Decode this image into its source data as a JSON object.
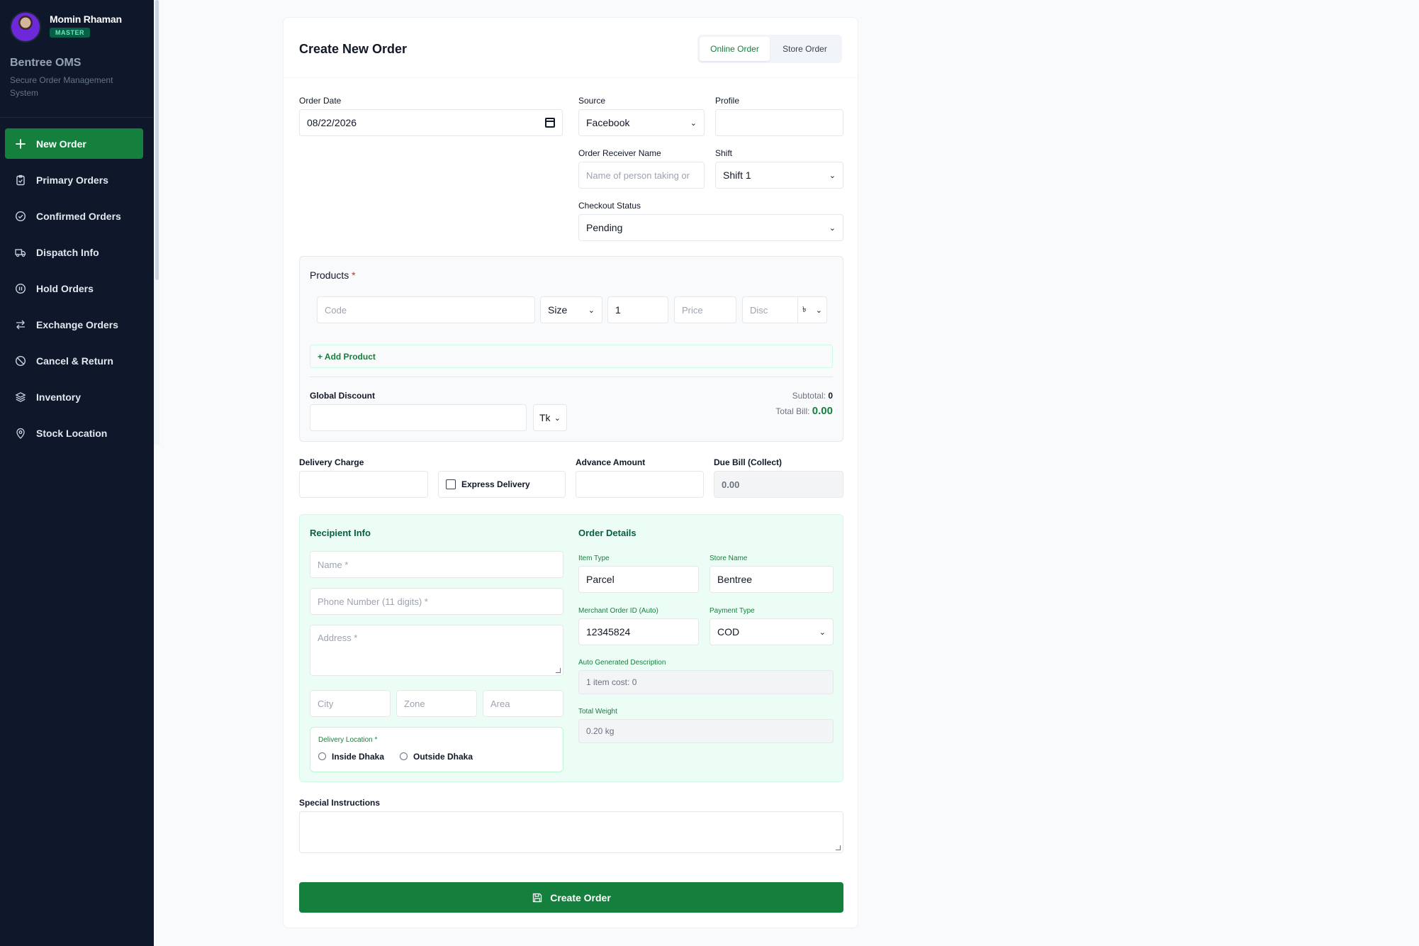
{
  "user": {
    "name": "Momin Rhaman",
    "role": "MASTER"
  },
  "app": {
    "name": "Bentree OMS",
    "subtitle": "Secure Order Management System"
  },
  "nav": [
    {
      "label": "New Order",
      "icon": "plus-icon",
      "active": true
    },
    {
      "label": "Primary Orders",
      "icon": "clipboard-icon"
    },
    {
      "label": "Confirmed Orders",
      "icon": "check-circle-icon"
    },
    {
      "label": "Dispatch Info",
      "icon": "truck-icon"
    },
    {
      "label": "Hold Orders",
      "icon": "pause-circle-icon"
    },
    {
      "label": "Exchange Orders",
      "icon": "exchange-icon"
    },
    {
      "label": "Cancel & Return",
      "icon": "ban-icon"
    },
    {
      "label": "Inventory",
      "icon": "layers-icon"
    },
    {
      "label": "Stock Location",
      "icon": "map-pin-icon"
    }
  ],
  "form": {
    "title": "Create New Order",
    "order_type_tabs": [
      "Online Order",
      "Store Order"
    ],
    "order_date": {
      "label": "Order Date",
      "value": "08/22/2026"
    },
    "source": {
      "label": "Source",
      "value": "Facebook"
    },
    "profile": {
      "label": "Profile",
      "value": ""
    },
    "receiver": {
      "label": "Order Receiver Name",
      "placeholder": "Name of person taking or"
    },
    "shift": {
      "label": "Shift",
      "value": "Shift 1"
    },
    "checkout": {
      "label": "Checkout Status",
      "value": "Pending"
    },
    "products": {
      "label": "Products",
      "required_mark": "*",
      "code_placeholder": "Code",
      "size_value": "Size",
      "qty_value": "1",
      "price_placeholder": "Price",
      "disc_placeholder": "Disc",
      "disc_type": "৳",
      "add_label": "+ Add Product",
      "global_discount_label": "Global Discount",
      "discount_unit": "Tk",
      "subtotal_label": "Subtotal:",
      "subtotal_value": "0",
      "total_label": "Total Bill:",
      "total_value": "0.00"
    },
    "delivery_charge": {
      "label": "Delivery Charge",
      "value": ""
    },
    "express": {
      "label": "Express Delivery"
    },
    "advance": {
      "label": "Advance Amount",
      "value": ""
    },
    "due": {
      "label": "Due Bill (Collect)",
      "value": "0.00"
    },
    "recipient": {
      "title": "Recipient Info",
      "name_placeholder": "Name *",
      "phone_placeholder": "Phone Number (11 digits) *",
      "address_placeholder": "Address *",
      "city_placeholder": "City",
      "zone_placeholder": "Zone",
      "area_placeholder": "Area",
      "location_label": "Delivery Location *",
      "location_options": [
        "Inside Dhaka",
        "Outside Dhaka"
      ]
    },
    "order_details": {
      "title": "Order Details",
      "item_type_label": "Item Type",
      "item_type_value": "Parcel",
      "store_name_label": "Store Name",
      "store_name_value": "Bentree",
      "merchant_id_label": "Merchant Order ID (Auto)",
      "merchant_id_value": "12345824",
      "payment_label": "Payment Type",
      "payment_value": "COD",
      "desc_label": "Auto Generated Description",
      "desc_value": "1 item cost: 0",
      "weight_label": "Total Weight",
      "weight_value": "0.20 kg"
    },
    "special": {
      "label": "Special Instructions",
      "value": ""
    },
    "submit_label": "Create Order"
  },
  "colors": {
    "sidebar_bg": "#0f172a",
    "accent": "#15803d",
    "panel_bg": "#ecfdf5"
  }
}
